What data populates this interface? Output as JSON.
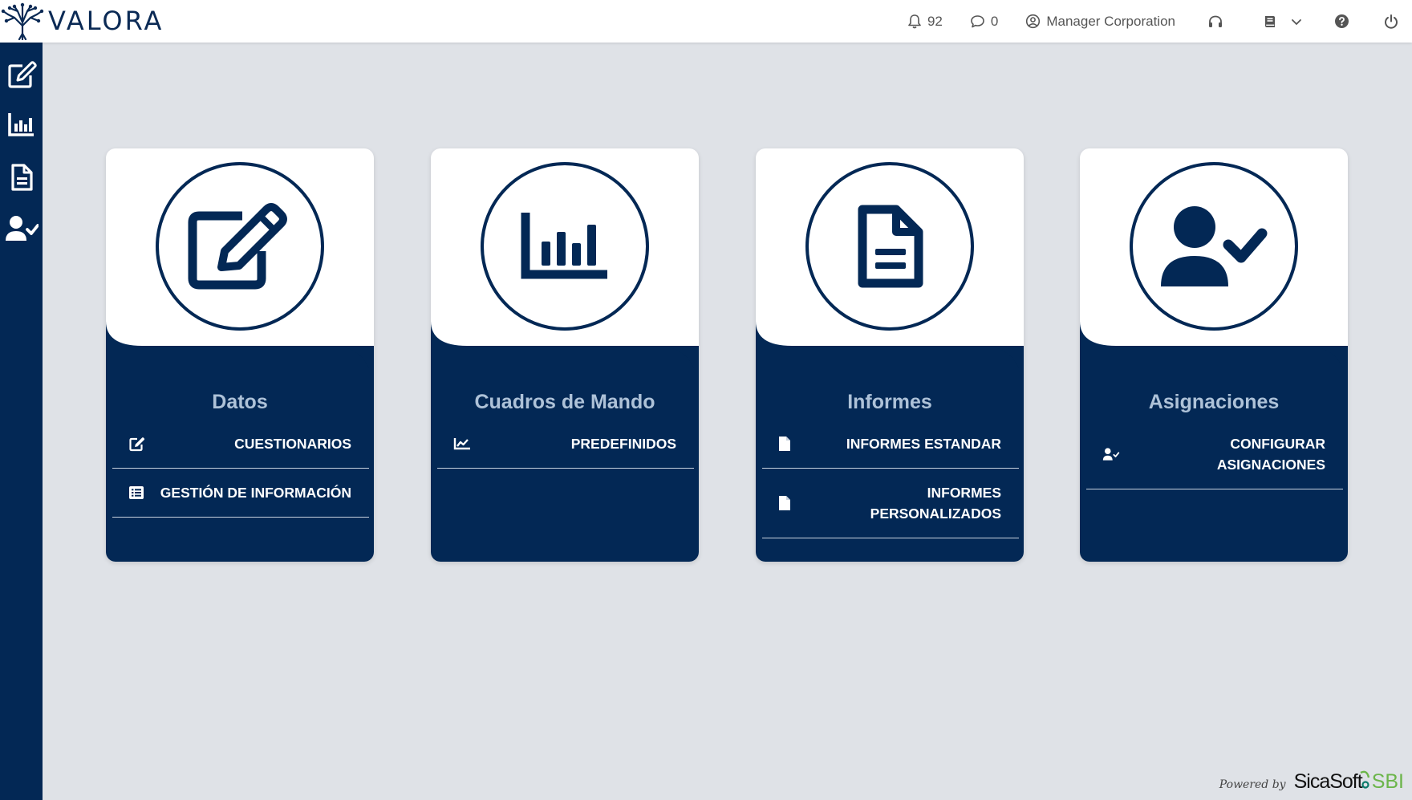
{
  "app": {
    "brand": "VALORA"
  },
  "header": {
    "notifications_count": "92",
    "messages_count": "0",
    "user_name": "Manager Corporation"
  },
  "colors": {
    "navy": "#032855",
    "title_light": "#aec2d8",
    "background": "#dfe2e7",
    "brand_green": "#6bb54a"
  },
  "sidebar": {
    "items": [
      {
        "icon": "edit-icon"
      },
      {
        "icon": "chart-bar-icon"
      },
      {
        "icon": "document-icon"
      },
      {
        "icon": "user-check-icon"
      }
    ]
  },
  "cards": [
    {
      "title": "Datos",
      "icon": "edit-icon",
      "items": [
        {
          "label": "CUESTIONARIOS",
          "icon": "edit-icon"
        },
        {
          "label": "GESTIÓN DE INFORMACIÓN",
          "icon": "list-icon"
        }
      ]
    },
    {
      "title": "Cuadros de Mando",
      "icon": "chart-bar-icon",
      "items": [
        {
          "label": "PREDEFINIDOS",
          "icon": "chart-line-icon"
        }
      ]
    },
    {
      "title": "Informes",
      "icon": "document-icon",
      "items": [
        {
          "label": "INFORMES ESTANDAR",
          "icon": "file-icon"
        },
        {
          "label": "INFORMES PERSONALIZADOS",
          "icon": "file-icon"
        }
      ]
    },
    {
      "title": "Asignaciones",
      "icon": "user-check-icon",
      "items": [
        {
          "label": "CONFIGURAR ASIGNACIONES",
          "icon": "user-check-icon"
        }
      ]
    }
  ],
  "footer": {
    "powered_by": "Powered by",
    "company": "SicaSoft",
    "product": "SBI"
  }
}
